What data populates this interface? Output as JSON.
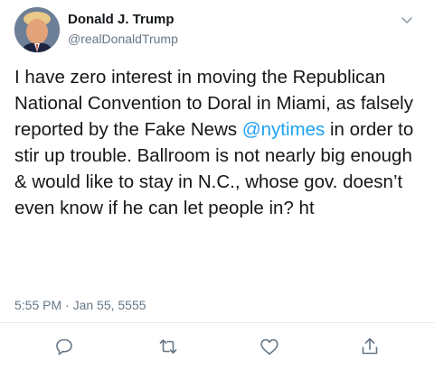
{
  "tweet": {
    "display_name": "Donald J. Trump",
    "handle": "@realDonaldTrump",
    "text_before": "I have zero interest in moving the Republican National Convention to Doral in Miami, as falsely reported by the Fake News ",
    "mention": "@nytimes",
    "text_after": " in order to stir up trouble. Ballroom is not nearly big enough & would like to stay in N.C., whose gov. doesn’t even know if he can let people in? ht",
    "timestamp": "5:55 PM · Jan 55, 5555"
  },
  "icons": {
    "caret": "chevron-down-icon",
    "reply": "reply-icon",
    "retweet": "retweet-icon",
    "like": "heart-icon",
    "share": "share-icon"
  },
  "colors": {
    "link": "#1da1f2",
    "secondary_text": "#657786",
    "primary_text": "#14171a",
    "divider": "#e6ecf0"
  }
}
